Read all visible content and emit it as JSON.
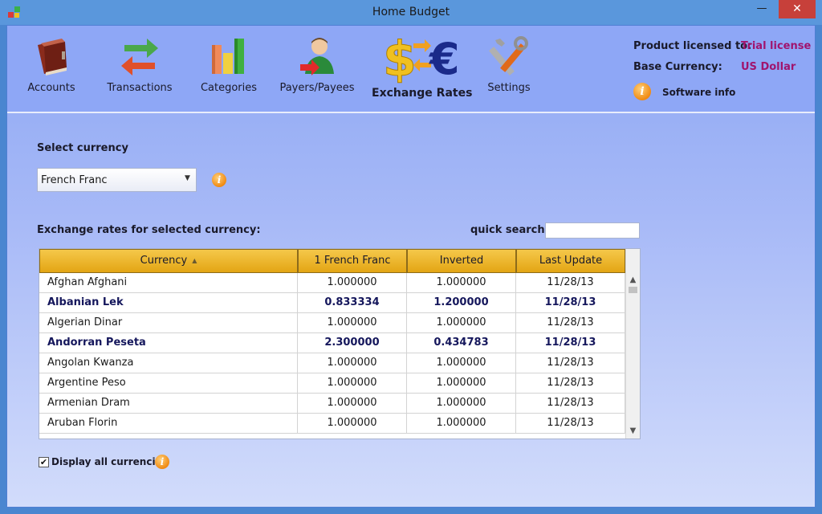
{
  "window": {
    "title": "Home Budget",
    "minimize": "—",
    "maximize": "□",
    "close": "✕"
  },
  "toolbar": {
    "items": [
      {
        "label": "Accounts",
        "icon": "book-icon"
      },
      {
        "label": "Transactions",
        "icon": "arrows-icon"
      },
      {
        "label": "Categories",
        "icon": "bar-chart-icon"
      },
      {
        "label": "Payers/Payees",
        "icon": "person-icon"
      },
      {
        "label": "Exchange Rates",
        "icon": "currency-exchange-icon",
        "active": true
      },
      {
        "label": "Settings",
        "icon": "tools-icon"
      }
    ]
  },
  "license": {
    "product_label": "Product licensed to:",
    "product_value": "Trial license",
    "base_label": "Base Currency:",
    "base_value": "US Dollar",
    "software_info": "Software info"
  },
  "form": {
    "select_label": "Select currency",
    "selected_currency": "French Franc",
    "rates_label": "Exchange rates for selected currency:",
    "search_label": "quick search",
    "search_value": "",
    "display_all_label": "Display all currencies",
    "display_all_checked": true
  },
  "table": {
    "columns": [
      "Currency",
      "1 French Franc",
      "Inverted",
      "Last Update"
    ],
    "rows": [
      {
        "currency": "Afghan Afghani",
        "rate": "1.000000",
        "inverted": "1.000000",
        "updated": "11/28/13",
        "bold": false
      },
      {
        "currency": "Albanian Lek",
        "rate": "0.833334",
        "inverted": "1.200000",
        "updated": "11/28/13",
        "bold": true
      },
      {
        "currency": "Algerian Dinar",
        "rate": "1.000000",
        "inverted": "1.000000",
        "updated": "11/28/13",
        "bold": false
      },
      {
        "currency": "Andorran Peseta",
        "rate": "2.300000",
        "inverted": "0.434783",
        "updated": "11/28/13",
        "bold": true
      },
      {
        "currency": "Angolan Kwanza",
        "rate": "1.000000",
        "inverted": "1.000000",
        "updated": "11/28/13",
        "bold": false
      },
      {
        "currency": "Argentine Peso",
        "rate": "1.000000",
        "inverted": "1.000000",
        "updated": "11/28/13",
        "bold": false
      },
      {
        "currency": "Armenian Dram",
        "rate": "1.000000",
        "inverted": "1.000000",
        "updated": "11/28/13",
        "bold": false
      },
      {
        "currency": "Aruban Florin",
        "rate": "1.000000",
        "inverted": "1.000000",
        "updated": "11/28/13",
        "bold": false
      }
    ]
  },
  "colors": {
    "accent": "#a0146e",
    "header": "#e3a514",
    "toolbar": "#8ea7f6"
  }
}
